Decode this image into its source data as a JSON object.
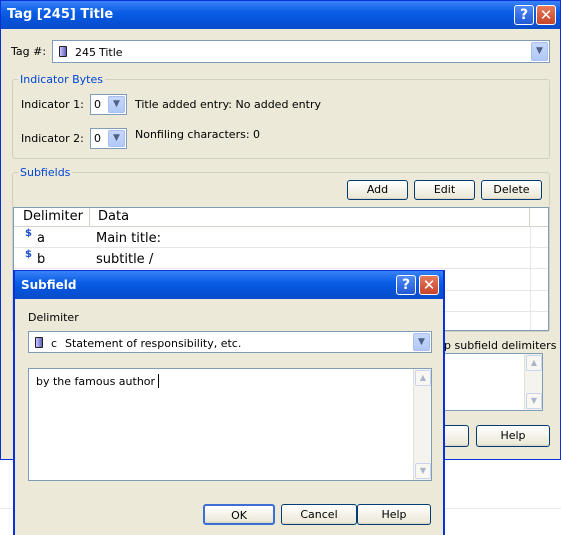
{
  "main_window": {
    "title": "Tag [245] Title",
    "tag_label": "Tag #:",
    "tag_number": "245",
    "tag_name": "Title",
    "indicator_group_label": "Indicator Bytes",
    "indicator1_label": "Indicator 1:",
    "indicator1_value": "0",
    "indicator1_desc": "Title added entry: No added entry",
    "indicator2_label": "Indicator 2:",
    "indicator2_value": "0",
    "indicator2_desc": "Nonfiling characters: 0",
    "subfields_group_label": "Subfields",
    "add_label": "Add",
    "edit_label": "Edit",
    "delete_label": "Delete",
    "col_delimiter": "Delimiter",
    "col_data": "Data",
    "rows": [
      {
        "delim_symbol": "$",
        "delim": "a",
        "data": "Main title:"
      },
      {
        "delim_symbol": "$",
        "delim": "b",
        "data": "subtitle /"
      }
    ],
    "partial_checkbox_label": "ip subfield delimiters",
    "help_label": "Help"
  },
  "subfield_dialog": {
    "title": "Subfield",
    "delimiter_label": "Delimiter",
    "delimiter_code": "c",
    "delimiter_name": "Statement of responsibility, etc.",
    "text_value": "by the famous author",
    "ok_label": "OK",
    "cancel_label": "Cancel",
    "help_label": "Help"
  }
}
